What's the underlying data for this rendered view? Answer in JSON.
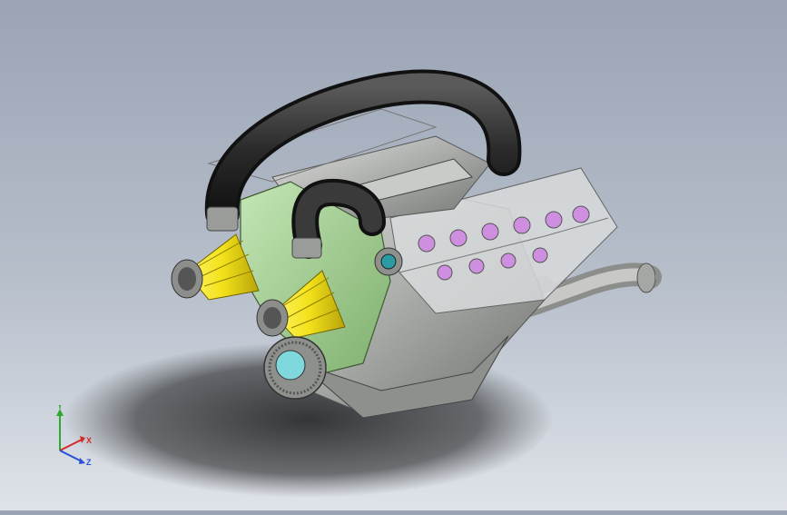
{
  "viewport": {
    "background_top": "#9aa4b4",
    "background_bottom": "#dfe3e9",
    "model": "engine-assembly"
  },
  "triad": {
    "x_label": "X",
    "y_label": "Y",
    "z_label": "Z",
    "x_color": "#d42a2a",
    "y_color": "#2fa82f",
    "z_color": "#2a4fd4"
  },
  "colors": {
    "intake_yellow": "#f3e21a",
    "block_green": "#9ecf8e",
    "hose_black": "#2b2b2b",
    "metal_gray": "#b9bbb9",
    "pulley_cyan": "#7fd8dc",
    "valve_purple": "#cf8fe0"
  }
}
